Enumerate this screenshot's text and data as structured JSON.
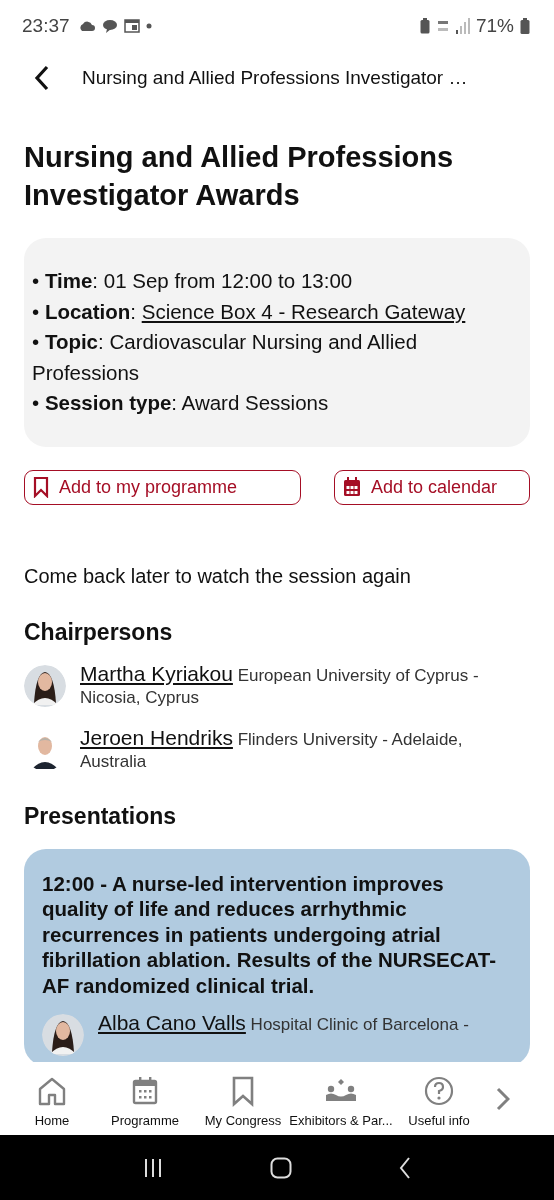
{
  "status_bar": {
    "time": "23:37",
    "battery": "71%"
  },
  "header": {
    "title": "Nursing and Allied Professions Investigator …"
  },
  "session": {
    "title": "Nursing and Allied Professions Investigator Awards",
    "details": [
      {
        "text": "• **Time**: 01 Sep from 12:00 to 13:00",
        "kind": "text"
      },
      {
        "text": "• **Location**:",
        "link": "Science Box 4 - Research Gateway",
        "kind": "link"
      },
      {
        "text": "• **Topic**: Cardiovascular Nursing and Allied Professions",
        "kind": "text"
      },
      {
        "text": "• **Session type**: Award Sessions",
        "kind": "text"
      }
    ]
  },
  "actions": [
    {
      "label": "Add to my programme",
      "kind": "bookmark"
    },
    {
      "label": "Add to calendar",
      "kind": "calendar"
    }
  ],
  "notice": "Come back later to watch the session again",
  "chairpersons": {
    "heading": "Chairpersons",
    "people": [
      {
        "name": "Martha Kyriakou",
        "affiliation": "European University of Cyprus - Nicosia, Cyprus",
        "kind": "woman"
      },
      {
        "name": "Jeroen Hendriks",
        "affiliation": "Flinders University - Adelaide, Australia",
        "kind": "man"
      }
    ]
  },
  "presentations": {
    "heading": "Presentations",
    "items": [
      {
        "title": "12:00 - A nurse-led intervention improves quality of life and reduces arrhythmic recurrences in patients undergoing atrial fibrillation ablation. Results of the NURSECAT-AF randomized clinical trial.",
        "speaker": {
          "name": "Alba Cano Valls",
          "affiliation": "Hospital Clinic of Barcelona -",
          "kind": "woman"
        }
      }
    ]
  },
  "bottom_nav": [
    {
      "label": "Home",
      "kind": "home",
      "selected": false
    },
    {
      "label": "Programme",
      "kind": "calendar",
      "selected": false
    },
    {
      "label": "My Congress",
      "kind": "bookmark",
      "selected": false
    },
    {
      "label": "Exhibitors & Par...",
      "kind": "people",
      "selected": false
    },
    {
      "label": "Useful info",
      "kind": "help",
      "selected": false
    }
  ]
}
